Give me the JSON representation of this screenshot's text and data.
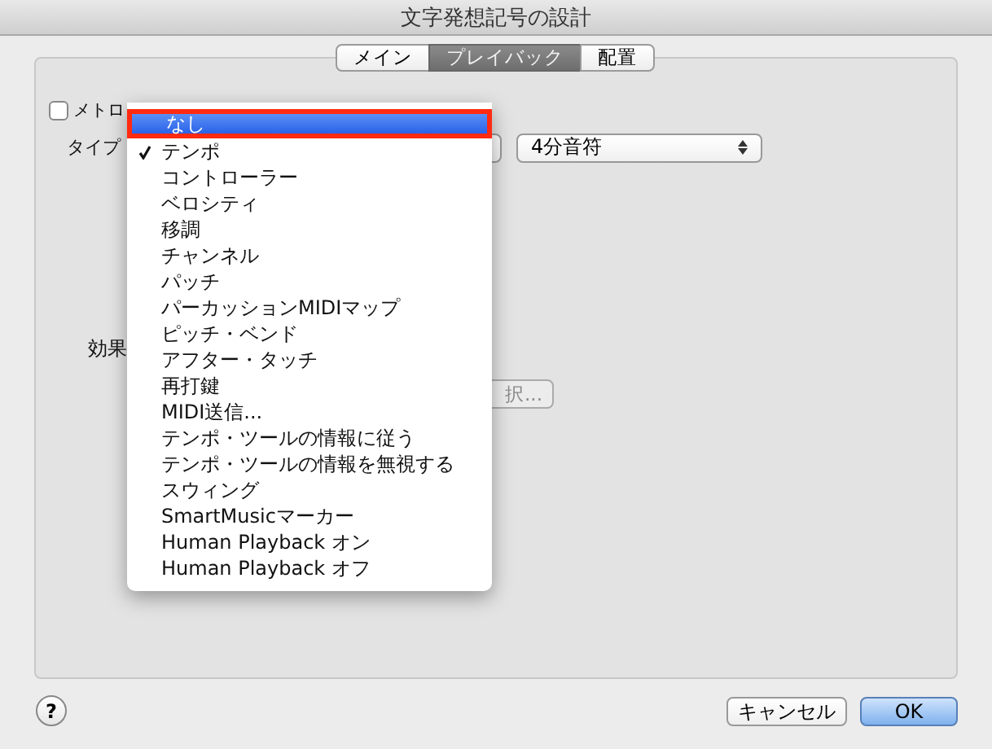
{
  "window": {
    "title": "文字発想記号の設計"
  },
  "tabs": [
    {
      "label": "メイン",
      "selected": false
    },
    {
      "label": "プレイバック",
      "selected": true
    },
    {
      "label": "配置",
      "selected": false
    }
  ],
  "metronome_checkbox": {
    "label": "メトロ",
    "checked": false
  },
  "type_label": "タイプ",
  "note_popup": {
    "value": "4分音符"
  },
  "effect_label": "効果",
  "select_button": {
    "label": "択..."
  },
  "type_menu": [
    {
      "label": "なし",
      "selected": true,
      "checked": false
    },
    {
      "label": "テンポ",
      "selected": false,
      "checked": true
    },
    {
      "label": "コントローラー",
      "selected": false,
      "checked": false
    },
    {
      "label": "ベロシティ",
      "selected": false,
      "checked": false
    },
    {
      "label": "移調",
      "selected": false,
      "checked": false
    },
    {
      "label": "チャンネル",
      "selected": false,
      "checked": false
    },
    {
      "label": "パッチ",
      "selected": false,
      "checked": false
    },
    {
      "label": "パーカッションMIDIマップ",
      "selected": false,
      "checked": false
    },
    {
      "label": "ピッチ・ベンド",
      "selected": false,
      "checked": false
    },
    {
      "label": "アフター・タッチ",
      "selected": false,
      "checked": false
    },
    {
      "label": "再打鍵",
      "selected": false,
      "checked": false
    },
    {
      "label": "MIDI送信...",
      "selected": false,
      "checked": false
    },
    {
      "label": "テンポ・ツールの情報に従う",
      "selected": false,
      "checked": false
    },
    {
      "label": "テンポ・ツールの情報を無視する",
      "selected": false,
      "checked": false
    },
    {
      "label": "スウィング",
      "selected": false,
      "checked": false
    },
    {
      "label": "SmartMusicマーカー",
      "selected": false,
      "checked": false
    },
    {
      "label": "Human Playback オン",
      "selected": false,
      "checked": false
    },
    {
      "label": "Human Playback オフ",
      "selected": false,
      "checked": false
    }
  ],
  "help_button": {
    "label": "?"
  },
  "buttons": [
    {
      "label": "キャンセル",
      "kind": "normal"
    },
    {
      "label": "OK",
      "kind": "default"
    }
  ]
}
